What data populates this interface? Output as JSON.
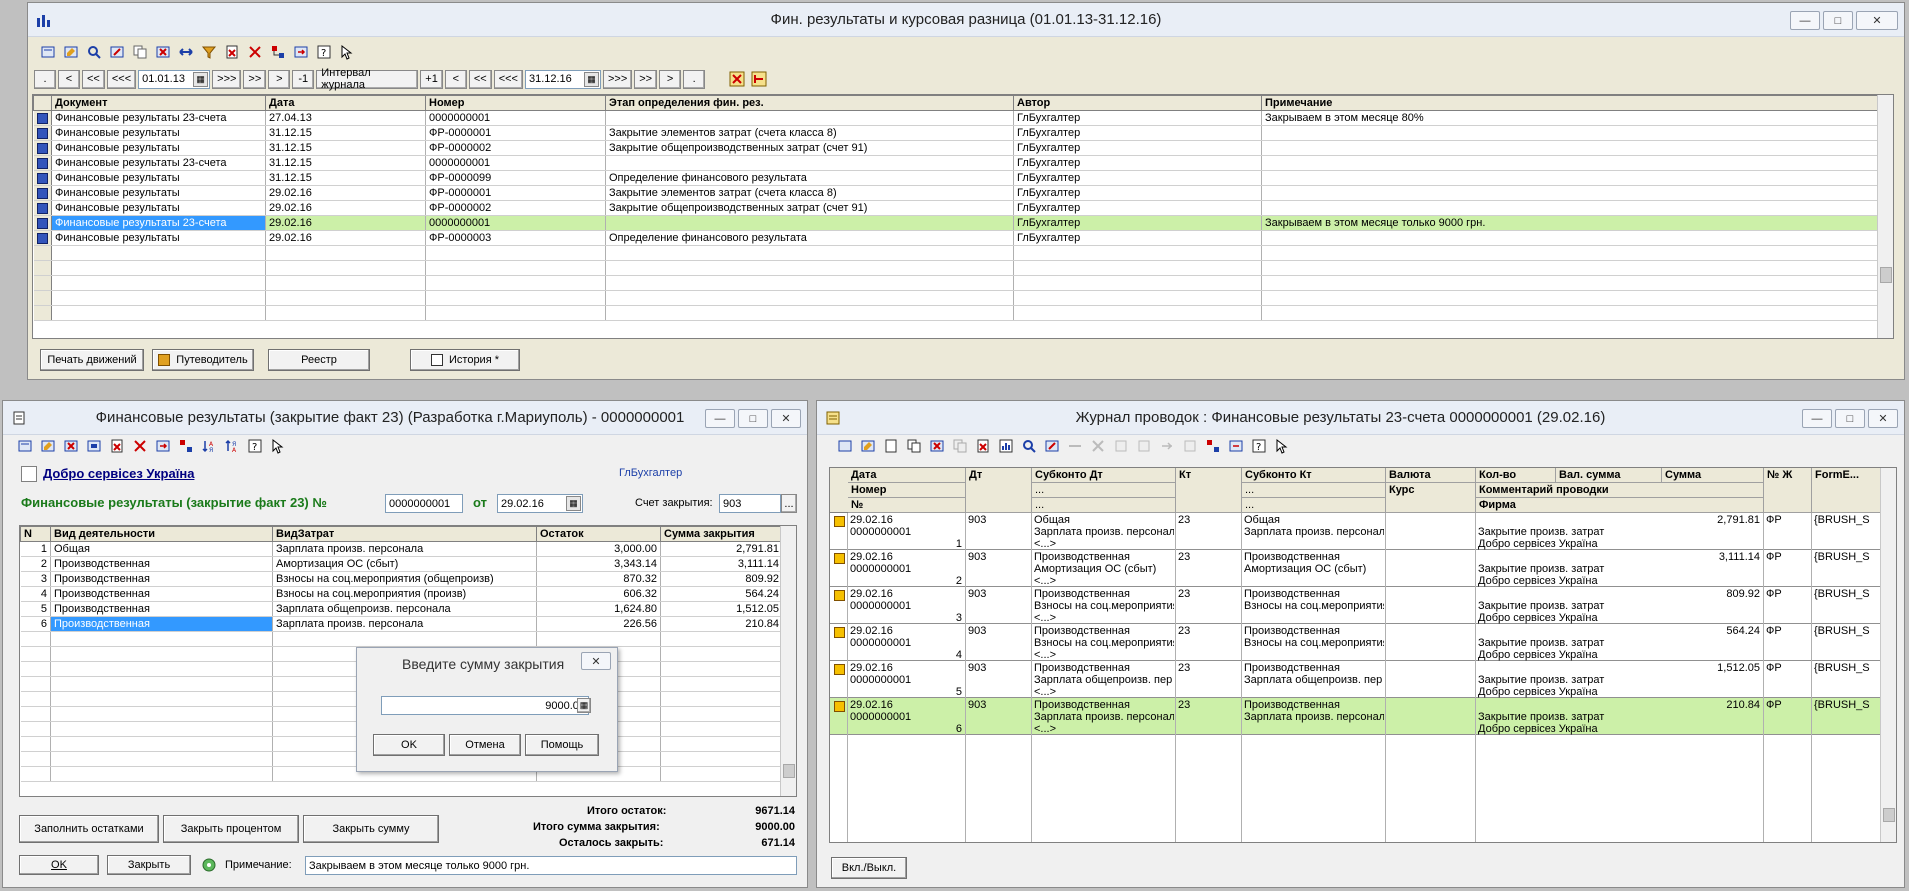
{
  "journal": {
    "title": "Фин. результаты и курсовая разница (01.01.13-31.12.16)",
    "nav": {
      "dot": ".",
      "lt": "<",
      "llt": "<<",
      "lllt": "<<<",
      "date_from": "01.01.13",
      "gtgtgt": ">>>",
      "gtgt": ">>",
      "gt": ">",
      "minus1": "-1",
      "interval": "Интервал журнала",
      "plus1": "+1",
      "date_to": "31.12.16"
    },
    "columns": [
      "Документ",
      "Дата",
      "Номер",
      "Этап определения фин. рез.",
      "Автор",
      "Примечание"
    ],
    "rows": [
      [
        "Финансовые результаты 23-счета",
        "27.04.13",
        "0000000001",
        "",
        "ГлБухгалтер",
        "Закрываем в этом месяце 80%"
      ],
      [
        "Финансовые результаты",
        "31.12.15",
        "ФР-0000001",
        "Закрытие элементов затрат (счета класса 8)",
        "ГлБухгалтер",
        ""
      ],
      [
        "Финансовые результаты",
        "31.12.15",
        "ФР-0000002",
        "Закрытие общепроизводственных затрат (счет 91)",
        "ГлБухгалтер",
        ""
      ],
      [
        "Финансовые результаты 23-счета",
        "31.12.15",
        "0000000001",
        "",
        "ГлБухгалтер",
        ""
      ],
      [
        "Финансовые результаты",
        "31.12.15",
        "ФР-0000099",
        "Определение финансового результата",
        "ГлБухгалтер",
        ""
      ],
      [
        "Финансовые результаты",
        "29.02.16",
        "ФР-0000001",
        "Закрытие элементов затрат (счета класса 8)",
        "ГлБухгалтер",
        ""
      ],
      [
        "Финансовые результаты",
        "29.02.16",
        "ФР-0000002",
        "Закрытие общепроизводственных затрат (счет 91)",
        "ГлБухгалтер",
        ""
      ],
      [
        "Финансовые результаты 23-счета",
        "29.02.16",
        "0000000001",
        "",
        "ГлБухгалтер",
        "Закрываем в этом месяце только 9000 грн."
      ],
      [
        "Финансовые результаты",
        "29.02.16",
        "ФР-0000003",
        "Определение финансового результата",
        "ГлБухгалтер",
        ""
      ]
    ],
    "buttons": {
      "print": "Печать движений",
      "guide": "Путеводитель",
      "registry": "Реестр",
      "history": "История *"
    }
  },
  "doc": {
    "title": "Финансовые результаты (закрытие факт 23) (Разработка г.Мариуполь) - 0000000001",
    "firm": "Добро сервісез Україна",
    "author": "ГлБухгалтер",
    "heading": "Финансовые результаты (закрытие факт 23) №",
    "number": "0000000001",
    "from_label": "от",
    "date": "29.02.16",
    "account_label": "Счет закрытия:",
    "account": "903",
    "columns": [
      "N",
      "Вид деятельности",
      "ВидЗатрат",
      "Остаток",
      "Сумма закрытия"
    ],
    "rows": [
      [
        "1",
        "Общая",
        "Зарплата произв. персонала",
        "3,000.00",
        "2,791.81"
      ],
      [
        "2",
        "Производственная",
        "Амортизация ОС (сбыт)",
        "3,343.14",
        "3,111.14"
      ],
      [
        "3",
        "Производственная",
        "Взносы на соц.мероприятия (общепроизв)",
        "870.32",
        "809.92"
      ],
      [
        "4",
        "Производственная",
        "Взносы на соц.мероприятия (произв)",
        "606.32",
        "564.24"
      ],
      [
        "5",
        "Производственная",
        "Зарплата общепроизв. персонала",
        "1,624.80",
        "1,512.05"
      ],
      [
        "6",
        "Производственная",
        "Зарплата произв. персонала",
        "226.56",
        "210.84"
      ]
    ],
    "buttons": {
      "fill": "Заполнить остатками",
      "close_percent": "Закрыть процентом",
      "close_sum": "Закрыть сумму",
      "ok": "OK",
      "close": "Закрыть"
    },
    "totals": {
      "rest_label": "Итого остаток:",
      "rest": "9671.14",
      "sum_label": "Итого сумма закрытия:",
      "sum": "9000.00",
      "left_label": "Осталось закрыть:",
      "left": "671.14"
    },
    "note_label": "Примечание:",
    "note": "Закрываем в этом месяце только 9000 грн."
  },
  "dialog": {
    "title": "Введите сумму закрытия",
    "value": "9000.00",
    "ok": "OK",
    "cancel": "Отмена",
    "help": "Помощь"
  },
  "entries": {
    "title": "Журнал проводок : Финансовые результаты 23-счета 0000000001 (29.02.16)",
    "headers": {
      "date": "Дата",
      "number": "Номер",
      "n": "№",
      "dt": "Дт",
      "sub_dt": "Субконто Дт",
      "kt": "Кт",
      "sub_kt": "Субконто Кт",
      "dots": "...",
      "currency": "Валюта",
      "rate": "Курс",
      "qty": "Кол-во",
      "cur_sum": "Вал. сумма",
      "sum": "Сумма",
      "comment": "Комментарий проводки",
      "firm": "Фирма",
      "journal": "№ Ж",
      "form": "FormE..."
    },
    "rows": [
      {
        "date": "29.02.16",
        "num": "0000000001",
        "n": "1",
        "dt": "903",
        "s1": "Общая",
        "s2": "Зарплата произв. персонала",
        "s3": "<...>",
        "kt": "23",
        "k1": "Общая",
        "k2": "Зарплата произв. персонала",
        "sum": "2,791.81",
        "c1": "Закрытие произв. затрат",
        "c2": "Добро сервісез Україна",
        "j": "ФР",
        "f": "{BRUSH_S"
      },
      {
        "date": "29.02.16",
        "num": "0000000001",
        "n": "2",
        "dt": "903",
        "s1": "Производственная",
        "s2": "Амортизация ОС (сбыт)",
        "s3": "<...>",
        "kt": "23",
        "k1": "Производственная",
        "k2": "Амортизация ОС (сбыт)",
        "sum": "3,111.14",
        "c1": "Закрытие произв. затрат",
        "c2": "Добро сервісез Україна",
        "j": "ФР",
        "f": "{BRUSH_S"
      },
      {
        "date": "29.02.16",
        "num": "0000000001",
        "n": "3",
        "dt": "903",
        "s1": "Производственная",
        "s2": "Взносы на соц.мероприятия",
        "s3": "<...>",
        "kt": "23",
        "k1": "Производственная",
        "k2": "Взносы на соц.мероприятия",
        "sum": "809.92",
        "c1": "Закрытие произв. затрат",
        "c2": "Добро сервісез Україна",
        "j": "ФР",
        "f": "{BRUSH_S"
      },
      {
        "date": "29.02.16",
        "num": "0000000001",
        "n": "4",
        "dt": "903",
        "s1": "Производственная",
        "s2": "Взносы на соц.мероприятия",
        "s3": "<...>",
        "kt": "23",
        "k1": "Производственная",
        "k2": "Взносы на соц.мероприятия",
        "sum": "564.24",
        "c1": "Закрытие произв. затрат",
        "c2": "Добро сервісез Україна",
        "j": "ФР",
        "f": "{BRUSH_S"
      },
      {
        "date": "29.02.16",
        "num": "0000000001",
        "n": "5",
        "dt": "903",
        "s1": "Производственная",
        "s2": "Зарплата общепроизв. пер",
        "s3": "<...>",
        "kt": "23",
        "k1": "Производственная",
        "k2": "Зарплата общепроизв. пер",
        "sum": "1,512.05",
        "c1": "Закрытие произв. затрат",
        "c2": "Добро сервісез Україна",
        "j": "ФР",
        "f": "{BRUSH_S"
      },
      {
        "date": "29.02.16",
        "num": "0000000001",
        "n": "6",
        "dt": "903",
        "s1": "Производственная",
        "s2": "Зарплата произв. персонал",
        "s3": "<...>",
        "kt": "23",
        "k1": "Производственная",
        "k2": "Зарплата произв. персонал",
        "sum": "210.84",
        "c1": "Закрытие произв. затрат",
        "c2": "Добро сервісез Україна",
        "j": "ФР",
        "f": "{BRUSH_S"
      }
    ],
    "toggle": "Вкл./Выкл."
  }
}
